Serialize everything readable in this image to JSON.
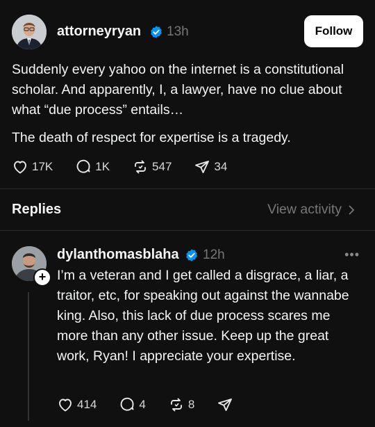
{
  "post": {
    "author": "attorneyryan",
    "time": "13h",
    "follow_label": "Follow",
    "text_p1": "Suddenly every yahoo on the internet is a constitutional scholar. And apparently, I, a lawyer, have no clue about what “due process” entails…",
    "text_p2": "The death of respect for expertise is a tragedy.",
    "likes": "17K",
    "comments": "1K",
    "reposts": "547",
    "shares": "34"
  },
  "replies_header": {
    "title": "Replies",
    "view_activity": "View activity"
  },
  "reply": {
    "author": "dylanthomasblaha",
    "time": "12h",
    "more": "•••",
    "plus": "+",
    "text": "I’m a veteran and I get called a disgrace, a liar, a traitor, etc, for speaking out against the wannabe king. Also, this lack of due process scares me more than any other issue. Keep up the great work, Ryan! I appreciate your expertise.",
    "likes": "414",
    "comments": "4",
    "reposts": "8"
  },
  "colors": {
    "background": "#101010",
    "verified": "#0095f6",
    "muted": "#777777"
  }
}
